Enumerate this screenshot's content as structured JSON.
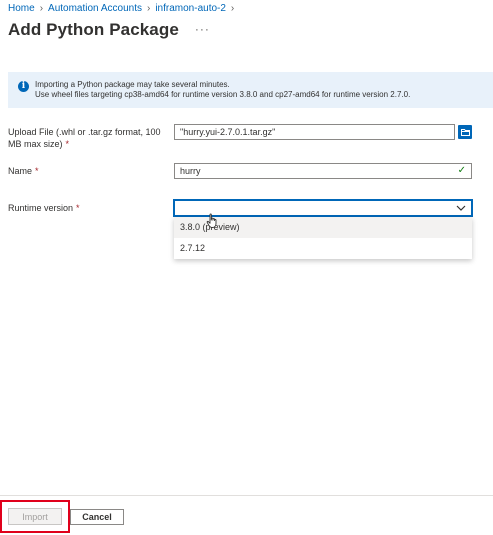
{
  "breadcrumb": {
    "items": [
      "Home",
      "Automation Accounts",
      "inframon-auto-2"
    ]
  },
  "page": {
    "title": "Add Python Package",
    "more": "···"
  },
  "info": {
    "line1": "Importing a Python package may take several minutes.",
    "line2": "Use wheel files targeting cp38-amd64 for runtime version 3.8.0 and cp27-amd64 for runtime version 2.7.0."
  },
  "form": {
    "upload": {
      "label_line1": "Upload File (.whl or .tar.gz format, 100",
      "label_line2": "MB max size)",
      "required": "*",
      "value": "\"hurry.yui-2.7.0.1.tar.gz\""
    },
    "name": {
      "label": "Name",
      "required": "*",
      "value": "hurry"
    },
    "runtime": {
      "label": "Runtime version",
      "required": "*",
      "value": "",
      "options": [
        "3.8.0 (preview)",
        "2.7.12"
      ]
    }
  },
  "footer": {
    "import_label": "Import",
    "cancel_label": "Cancel"
  },
  "colors": {
    "accent": "#0067b8",
    "required": "#a4262c",
    "highlight": "#e0001b",
    "banner": "#e8f1fa"
  }
}
